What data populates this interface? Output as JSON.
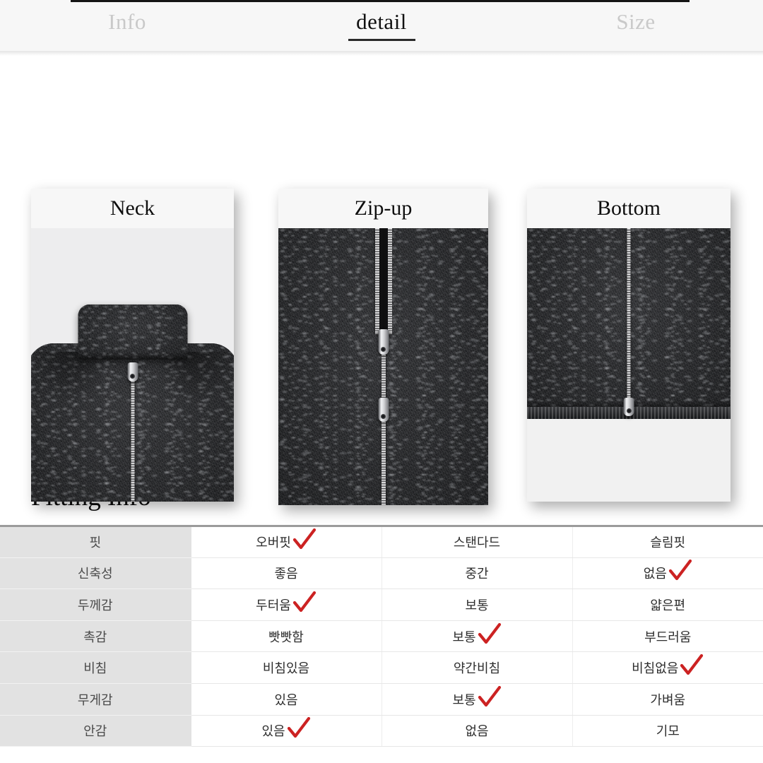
{
  "tabs": [
    {
      "label": "Info",
      "active": false
    },
    {
      "label": "detail",
      "active": true
    },
    {
      "label": "Size",
      "active": false
    }
  ],
  "detail_cards": [
    {
      "title": "Neck",
      "photo": "zip-up-fleece-collar-photo"
    },
    {
      "title": "Zip-up",
      "photo": "two-way-zipper-closeup-photo"
    },
    {
      "title": "Bottom",
      "photo": "fleece-hem-zipper-bottom-photo"
    }
  ],
  "fitting": {
    "heading": "Fitting Info",
    "rows": [
      {
        "label": "핏",
        "options": [
          {
            "text": "오버핏",
            "checked": true
          },
          {
            "text": "스탠다드",
            "checked": false
          },
          {
            "text": "슬림핏",
            "checked": false
          }
        ]
      },
      {
        "label": "신축성",
        "options": [
          {
            "text": "좋음",
            "checked": false
          },
          {
            "text": "중간",
            "checked": false
          },
          {
            "text": "없음",
            "checked": true
          }
        ]
      },
      {
        "label": "두께감",
        "options": [
          {
            "text": "두터움",
            "checked": true
          },
          {
            "text": "보통",
            "checked": false
          },
          {
            "text": "얇은편",
            "checked": false
          }
        ]
      },
      {
        "label": "촉감",
        "options": [
          {
            "text": "빳빳함",
            "checked": false
          },
          {
            "text": "보통",
            "checked": true
          },
          {
            "text": "부드러움",
            "checked": false
          }
        ]
      },
      {
        "label": "비침",
        "options": [
          {
            "text": "비침있음",
            "checked": false
          },
          {
            "text": "약간비침",
            "checked": false
          },
          {
            "text": "비침없음",
            "checked": true
          }
        ]
      },
      {
        "label": "무게감",
        "options": [
          {
            "text": "있음",
            "checked": false
          },
          {
            "text": "보통",
            "checked": true
          },
          {
            "text": "가벼움",
            "checked": false
          }
        ]
      },
      {
        "label": "안감",
        "options": [
          {
            "text": "있음",
            "checked": true
          },
          {
            "text": "없음",
            "checked": false
          },
          {
            "text": "기모",
            "checked": false
          }
        ]
      }
    ]
  },
  "colors": {
    "check_mark": "#cc2222",
    "active_tab_text": "#111111",
    "inactive_tab_text": "#c9c9c9",
    "label_cell_bg": "#e2e2e2",
    "table_top_border": "#9b9b9b",
    "card_header_bg": "#f7f7f7",
    "fabric_dark": "#2b2c2e"
  }
}
